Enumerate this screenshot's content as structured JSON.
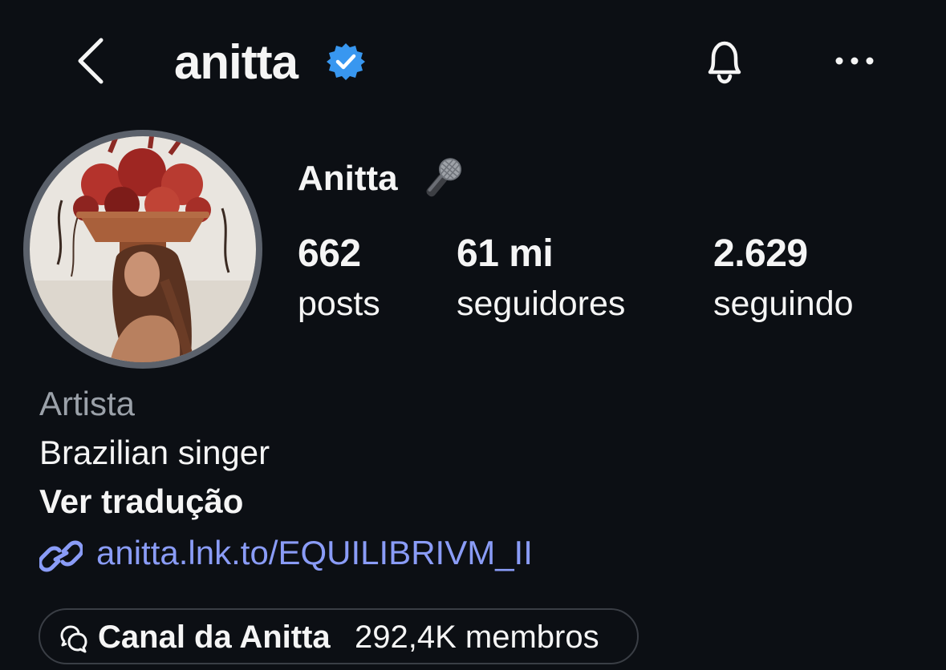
{
  "header": {
    "username": "anitta",
    "verified": true,
    "icons": {
      "back": "chevron-left-icon",
      "verified": "verified-badge-icon",
      "notifications": "bell-icon",
      "more": "more-horizontal-icon"
    }
  },
  "profile": {
    "display_name": "Anitta",
    "name_emoji": "microphone-icon",
    "avatar": "profile-photo"
  },
  "stats": [
    {
      "value": "662",
      "label": "posts"
    },
    {
      "value": "61 mi",
      "label": "seguidores"
    },
    {
      "value": "2.629",
      "label": "seguindo"
    }
  ],
  "bio": {
    "category": "Artista",
    "text": "Brazilian singer",
    "translate_label": "Ver tradução",
    "link_text": "anitta.lnk.to/EQUILIBRIVM_II",
    "link_icon": "link-icon"
  },
  "channel": {
    "icon": "chat-bubbles-icon",
    "name": "Canal da Anitta",
    "members": "292,4K membros"
  },
  "colors": {
    "background": "#0c0f14",
    "text": "#f5f5f5",
    "muted": "#9ba1a9",
    "link": "#8a9cf7",
    "verified": "#3897f0",
    "ring": "#5b616b"
  }
}
